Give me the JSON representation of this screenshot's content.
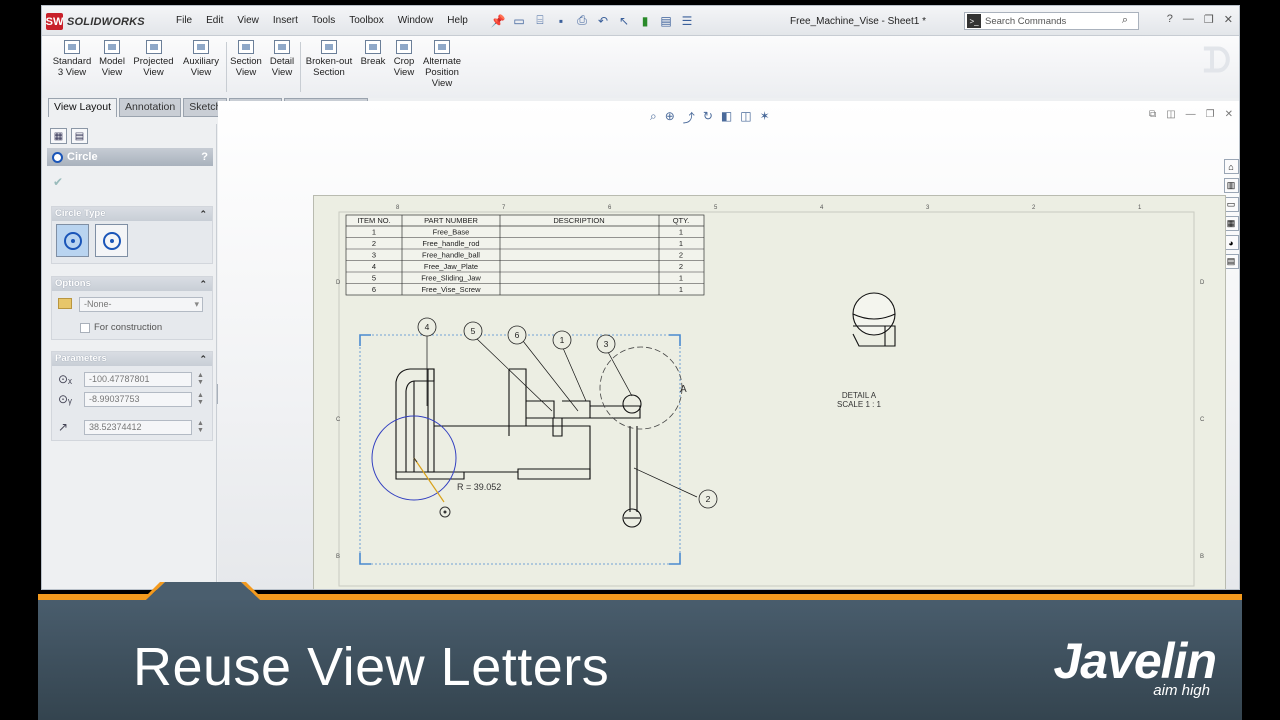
{
  "app": {
    "logo_badge": "SW",
    "logo_text": "SOLIDWORKS",
    "menu": [
      "File",
      "Edit",
      "View",
      "Insert",
      "Tools",
      "Toolbox",
      "Window",
      "Help"
    ],
    "document_title": "Free_Machine_Vise - Sheet1 *",
    "search_placeholder": "Search Commands"
  },
  "command_manager": [
    {
      "label": "Standard\n3 View"
    },
    {
      "label": "Model\nView"
    },
    {
      "label": "Projected\nView"
    },
    {
      "label": "Auxiliary\nView"
    },
    {
      "label": "Section\nView"
    },
    {
      "label": "Detail\nView"
    },
    {
      "label": "Broken-out\nSection"
    },
    {
      "label": "Break"
    },
    {
      "label": "Crop\nView"
    },
    {
      "label": "Alternate\nPosition\nView"
    }
  ],
  "tabs": [
    "View Layout",
    "Annotation",
    "Sketch",
    "Evaluate",
    "Office Products"
  ],
  "active_tab": "View Layout",
  "property_manager": {
    "title": "Circle",
    "help": "?",
    "circle_type_label": "Circle Type",
    "options_label": "Options",
    "layer_value": "-None-",
    "for_construction_label": "For construction",
    "for_construction_checked": false,
    "parameters_label": "Parameters",
    "center_x": "-100.47787801",
    "center_y": "-8.99037753",
    "radius": "38.52374412"
  },
  "drawing": {
    "bom_headers": [
      "ITEM NO.",
      "PART NUMBER",
      "DESCRIPTION",
      "QTY."
    ],
    "bom_rows": [
      {
        "item": "1",
        "part": "Free_Base",
        "desc": "",
        "qty": "1"
      },
      {
        "item": "2",
        "part": "Free_handle_rod",
        "desc": "",
        "qty": "1"
      },
      {
        "item": "3",
        "part": "Free_handle_ball",
        "desc": "",
        "qty": "2"
      },
      {
        "item": "4",
        "part": "Free_Jaw_Plate",
        "desc": "",
        "qty": "2"
      },
      {
        "item": "5",
        "part": "Free_Sliding_Jaw",
        "desc": "",
        "qty": "1"
      },
      {
        "item": "6",
        "part": "Free_Vise_Screw",
        "desc": "",
        "qty": "1"
      }
    ],
    "balloons": [
      "4",
      "5",
      "6",
      "1",
      "3",
      "2"
    ],
    "radius_readout": "R = 39.052",
    "detail_marker": "A",
    "detail_label_line1": "DETAIL A",
    "detail_label_line2": "SCALE 1 : 1",
    "zone_numbers_top": [
      "8",
      "7",
      "6",
      "5",
      "4",
      "3",
      "2",
      "1"
    ],
    "zone_letters_side": [
      "D",
      "C",
      "B"
    ]
  },
  "caption": {
    "text": "Reuse View Letters",
    "brand": "Javelin",
    "tagline": "aim high",
    "accent_color": "#f39a1e",
    "band_color": "#3d4f5e"
  }
}
